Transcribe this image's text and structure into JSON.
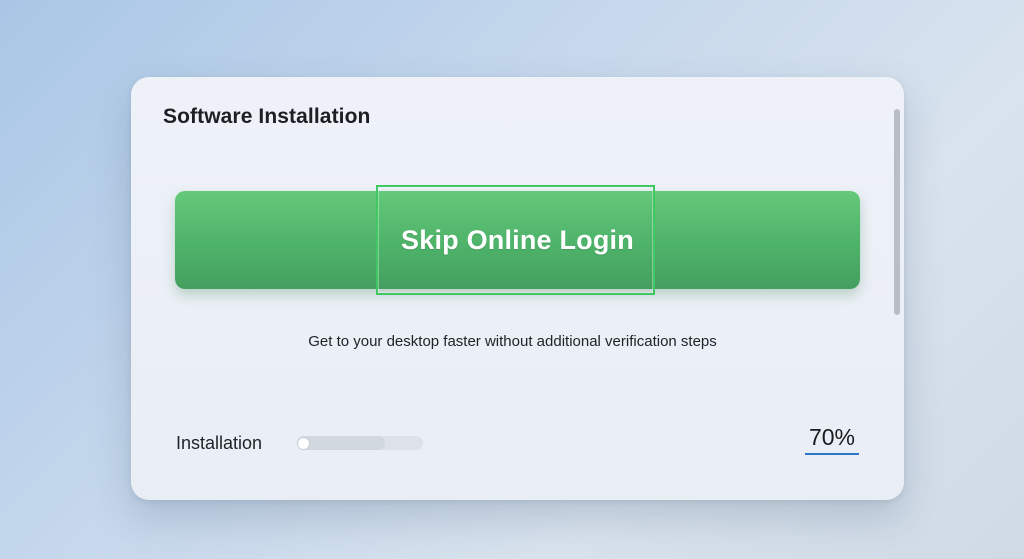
{
  "dialog": {
    "title": "Software Installation",
    "primary_button": {
      "label": "Skip Online Login",
      "color": "#4eb36a"
    },
    "description": "Get to your desktop faster without additional verification steps",
    "progress": {
      "label": "Installation",
      "value": 0.7,
      "percent_text": "70%",
      "accent_color": "#2f76c8"
    }
  }
}
